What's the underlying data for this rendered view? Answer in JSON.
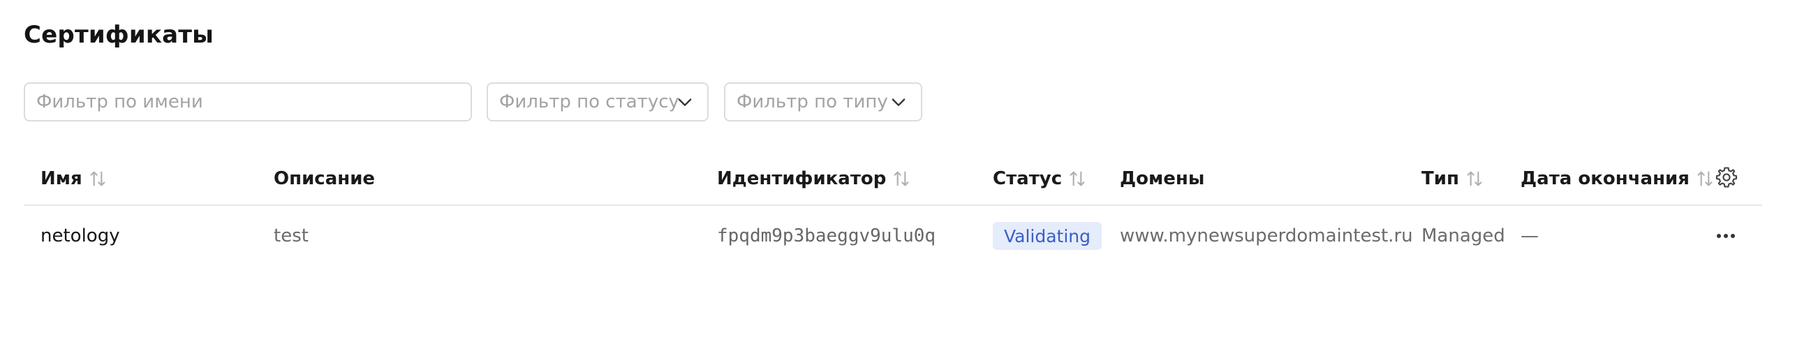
{
  "page": {
    "title": "Сертификаты"
  },
  "filters": {
    "name_placeholder": "Фильтр по имени",
    "status_placeholder": "Фильтр по статусу",
    "type_placeholder": "Фильтр по типу"
  },
  "table": {
    "columns": [
      {
        "key": "name",
        "label": "Имя",
        "sortable": true
      },
      {
        "key": "description",
        "label": "Описание",
        "sortable": false
      },
      {
        "key": "id",
        "label": "Идентификатор",
        "sortable": true
      },
      {
        "key": "status",
        "label": "Статус",
        "sortable": true
      },
      {
        "key": "domains",
        "label": "Домены",
        "sortable": false
      },
      {
        "key": "type",
        "label": "Тип",
        "sortable": true
      },
      {
        "key": "expires",
        "label": "Дата окончания",
        "sortable": true
      }
    ],
    "rows": [
      {
        "name": "netology",
        "description": "test",
        "id": "fpqdm9p3baeggv9ulu0q",
        "status": "Validating",
        "domains": "www.mynewsuperdomaintest.ru",
        "type": "Managed",
        "expires": "—"
      }
    ]
  },
  "icons": {
    "sort": "sort-arrows-icon",
    "settings": "gear-icon",
    "more": "more-horizontal-icon",
    "dropdown": "chevron-down-icon"
  },
  "colors": {
    "status_badge_bg": "#e5ecfb",
    "status_badge_text": "#3a5fc4"
  }
}
